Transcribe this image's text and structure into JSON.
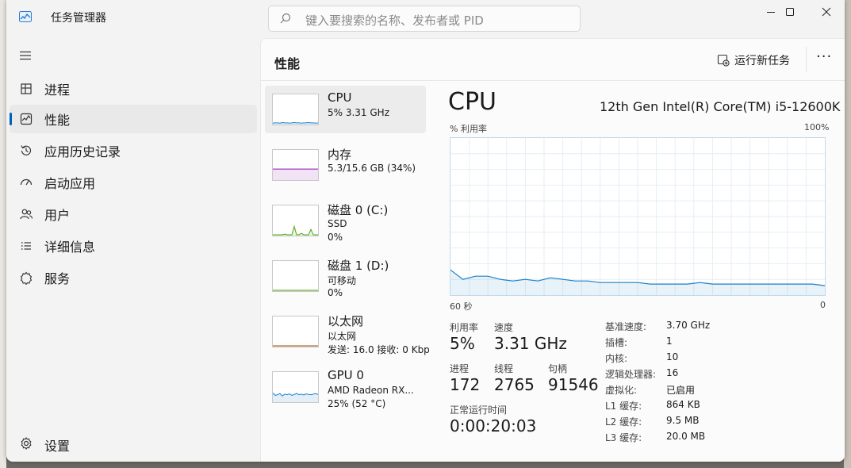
{
  "app": {
    "title": "任务管理器"
  },
  "search": {
    "placeholder": "键入要搜索的名称、发布者或 PID"
  },
  "window_controls": {
    "minimize_icon": "minimize-icon",
    "maximize_icon": "maximize-icon",
    "close_icon": "close-icon"
  },
  "sidebar": {
    "menu_icon": "hamburger-icon",
    "items": [
      {
        "label": "进程",
        "icon": "processes-icon",
        "active": false
      },
      {
        "label": "性能",
        "icon": "performance-icon",
        "active": true
      },
      {
        "label": "应用历史记录",
        "icon": "history-icon",
        "active": false
      },
      {
        "label": "启动应用",
        "icon": "startup-icon",
        "active": false
      },
      {
        "label": "用户",
        "icon": "users-icon",
        "active": false
      },
      {
        "label": "详细信息",
        "icon": "details-icon",
        "active": false
      },
      {
        "label": "服务",
        "icon": "services-icon",
        "active": false
      }
    ],
    "settings_label": "设置"
  },
  "header": {
    "title": "性能",
    "run_task_label": "运行新任务",
    "more_label": "···"
  },
  "devices": [
    {
      "name": "CPU",
      "sub1": "5% 3.31 GHz",
      "sub2": "",
      "color": "#1b7fc4",
      "active": true
    },
    {
      "name": "内存",
      "sub1": "5.3/15.6 GB (34%)",
      "sub2": "",
      "color": "#8b12ae",
      "active": false
    },
    {
      "name": "磁盘 0 (C:)",
      "sub1": "SSD",
      "sub2": "0%",
      "color": "#4da60c",
      "active": false
    },
    {
      "name": "磁盘 1 (D:)",
      "sub1": "可移动",
      "sub2": "0%",
      "color": "#4da60c",
      "active": false
    },
    {
      "name": "以太网",
      "sub1": "以太网",
      "sub2": "发送: 16.0 接收: 0 Kbp",
      "color": "#a74f01",
      "active": false
    },
    {
      "name": "GPU 0",
      "sub1": "AMD Radeon RX...",
      "sub2": "25% (52 °C)",
      "color": "#1b7fc4",
      "active": false
    }
  ],
  "detail": {
    "title": "CPU",
    "model": "12th Gen Intel(R) Core(TM) i5-12600K",
    "y_axis_label": "% 利用率",
    "y_max_label": "100%",
    "x_left_label": "60 秒",
    "x_right_label": "0",
    "stats": {
      "utilization": {
        "label": "利用率",
        "value": "5%"
      },
      "speed": {
        "label": "速度",
        "value": "3.31 GHz"
      },
      "processes": {
        "label": "进程",
        "value": "172"
      },
      "threads": {
        "label": "线程",
        "value": "2765"
      },
      "handles": {
        "label": "句柄",
        "value": "91546"
      },
      "uptime": {
        "label": "正常运行时间",
        "value": "0:00:20:03"
      }
    },
    "specs": [
      {
        "key": "基准速度:",
        "value": "3.70 GHz"
      },
      {
        "key": "插槽:",
        "value": "1"
      },
      {
        "key": "内核:",
        "value": "10"
      },
      {
        "key": "逻辑处理器:",
        "value": "16"
      },
      {
        "key": "虚拟化:",
        "value": "已启用"
      },
      {
        "key": "L1 缓存:",
        "value": "864 KB"
      },
      {
        "key": "L2 缓存:",
        "value": "9.5 MB"
      },
      {
        "key": "L3 缓存:",
        "value": "20.0 MB"
      }
    ]
  },
  "cpu_history": {
    "seconds": [
      60,
      58,
      56,
      54,
      52,
      50,
      48,
      46,
      44,
      42,
      40,
      38,
      36,
      34,
      32,
      30,
      28,
      26,
      24,
      22,
      20,
      18,
      16,
      14,
      12,
      10,
      8,
      6,
      4,
      2,
      0
    ],
    "values": [
      16,
      10,
      12,
      12,
      10,
      9,
      10,
      9,
      11,
      10,
      9,
      9,
      8,
      8,
      8,
      8,
      7,
      7,
      7,
      7,
      8,
      7,
      7,
      7,
      7,
      7,
      7,
      7,
      7,
      7,
      6
    ]
  },
  "thumbs": {
    "cpu": [
      2,
      3,
      3,
      2,
      4,
      3,
      3,
      2,
      3,
      4,
      3,
      3,
      2,
      3,
      3,
      4,
      3,
      3,
      2,
      3
    ],
    "memory": [
      34,
      34,
      34,
      34,
      34,
      34,
      34,
      34,
      34,
      34
    ],
    "disk0": [
      0,
      0,
      0,
      0,
      0,
      2,
      0,
      0,
      0,
      28,
      0,
      0,
      5,
      0,
      0,
      0,
      18,
      0,
      0,
      0
    ],
    "disk1": [
      0,
      0,
      0,
      0,
      0,
      0,
      0,
      0,
      0,
      0
    ],
    "ethernet": [
      0,
      0,
      0,
      0,
      0,
      0,
      0,
      0,
      0,
      0,
      0,
      0,
      0,
      0,
      0,
      0,
      0,
      0,
      0,
      0
    ],
    "gpu": [
      28,
      20,
      22,
      26,
      18,
      24,
      22,
      25,
      20,
      23,
      26,
      22,
      24,
      21,
      25,
      23,
      22,
      24,
      26,
      23
    ]
  }
}
